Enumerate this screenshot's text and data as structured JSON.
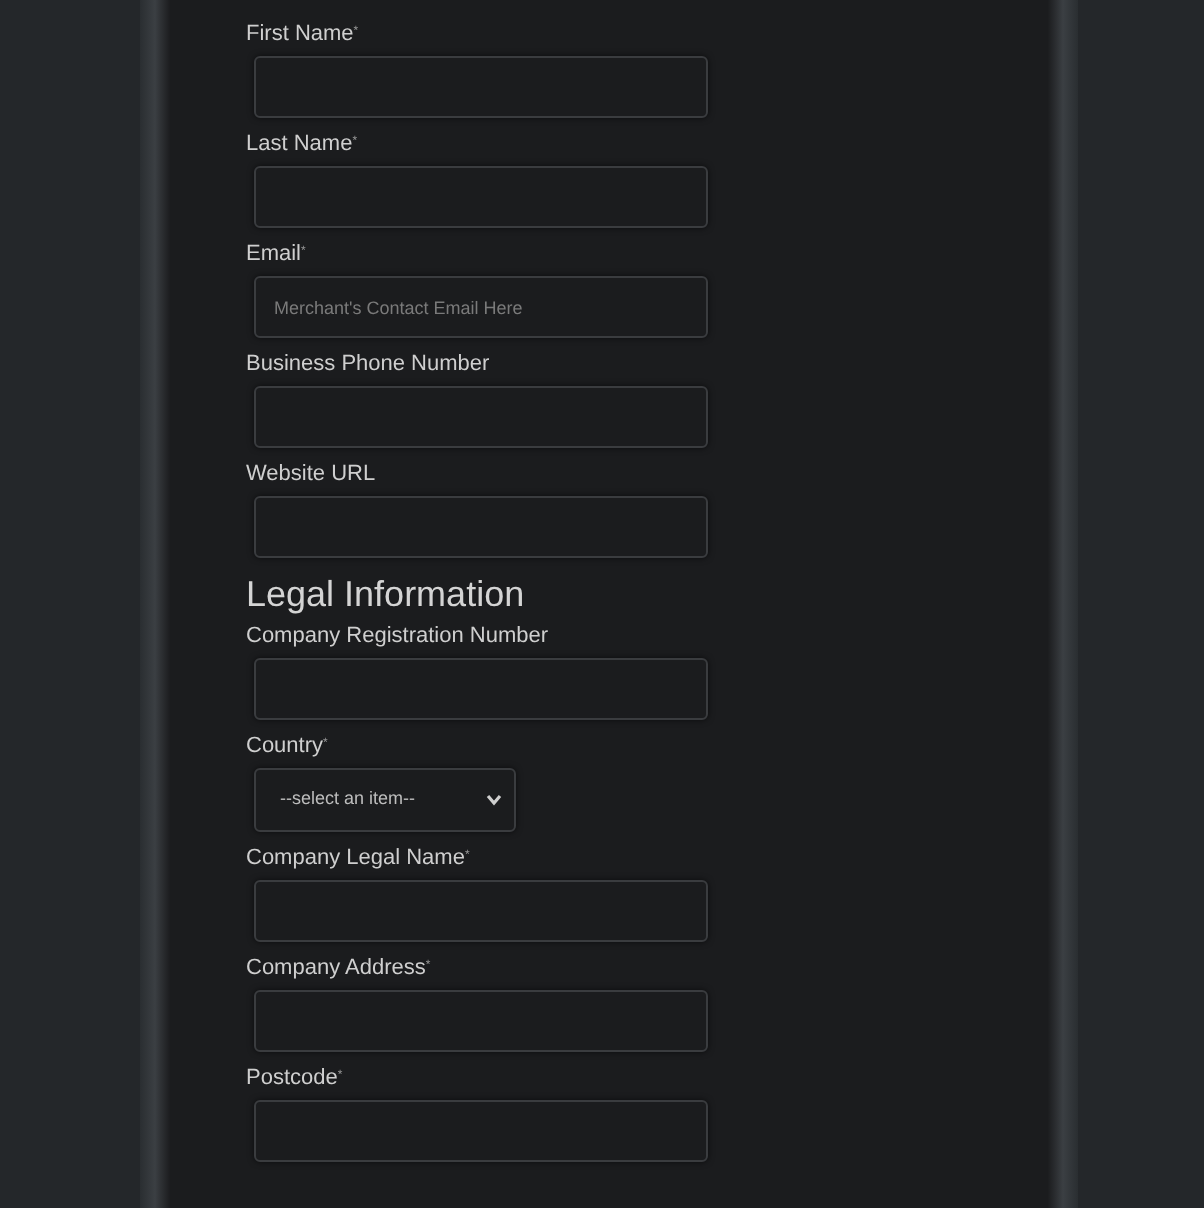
{
  "contact_fields": [
    {
      "kind": "text",
      "label": "First Name$^{*}$"
    },
    {
      "kind": "text",
      "label": "Last Name$^{*}$"
    },
    {
      "kind": "text",
      "label": "Email$^{*}$",
      "placeholder": "Merchant's Contact Email Here"
    },
    {
      "kind": "text",
      "label": "Business Phone Number"
    },
    {
      "kind": "text",
      "label": "Website URL"
    }
  ],
  "legal_section": {
    "heading": "Legal Information",
    "fields": [
      {
        "kind": "text",
        "label": "Company Registration Number"
      },
      {
        "kind": "select",
        "label": "Country$^{*}$",
        "value": "--select an item--"
      },
      {
        "kind": "text",
        "label": "Company Legal Name$^{*}$"
      },
      {
        "kind": "text",
        "label": "Company Address$^{*}$"
      },
      {
        "kind": "text",
        "label": "Postcode$^{*}$"
      }
    ]
  }
}
